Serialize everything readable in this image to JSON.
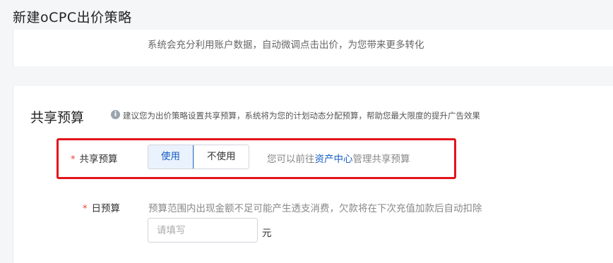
{
  "header": {
    "title": "新建oCPC出价策略"
  },
  "top_card": {
    "description": "系统会充分利用账户数据，自动微调点击出价，为您带来更多转化"
  },
  "budget_section": {
    "title": "共享预算",
    "info_icon": "info-circle-icon",
    "tip": "建议您为出价策略设置共享预算，系统将为您的计划动态分配预算，帮助您最大限度的提升广告效果",
    "share_row": {
      "required_mark": "*",
      "label": "共享预算",
      "options": [
        {
          "label": "使用",
          "selected": true
        },
        {
          "label": "不使用",
          "selected": false
        }
      ],
      "hint_prefix": "您可以前往",
      "hint_link": "资产中心",
      "hint_suffix": "管理共享预算"
    },
    "daily_row": {
      "required_mark": "*",
      "label": "日预算",
      "hint": "预算范围内出现金额不足可能产生透支消费，欠款将在下次充值加款后自动扣除",
      "input_value": "",
      "placeholder": "请填写",
      "unit": "元"
    }
  },
  "colors": {
    "accent": "#1a5fc4",
    "required": "#f04134",
    "highlight_border": "#e2141c"
  }
}
